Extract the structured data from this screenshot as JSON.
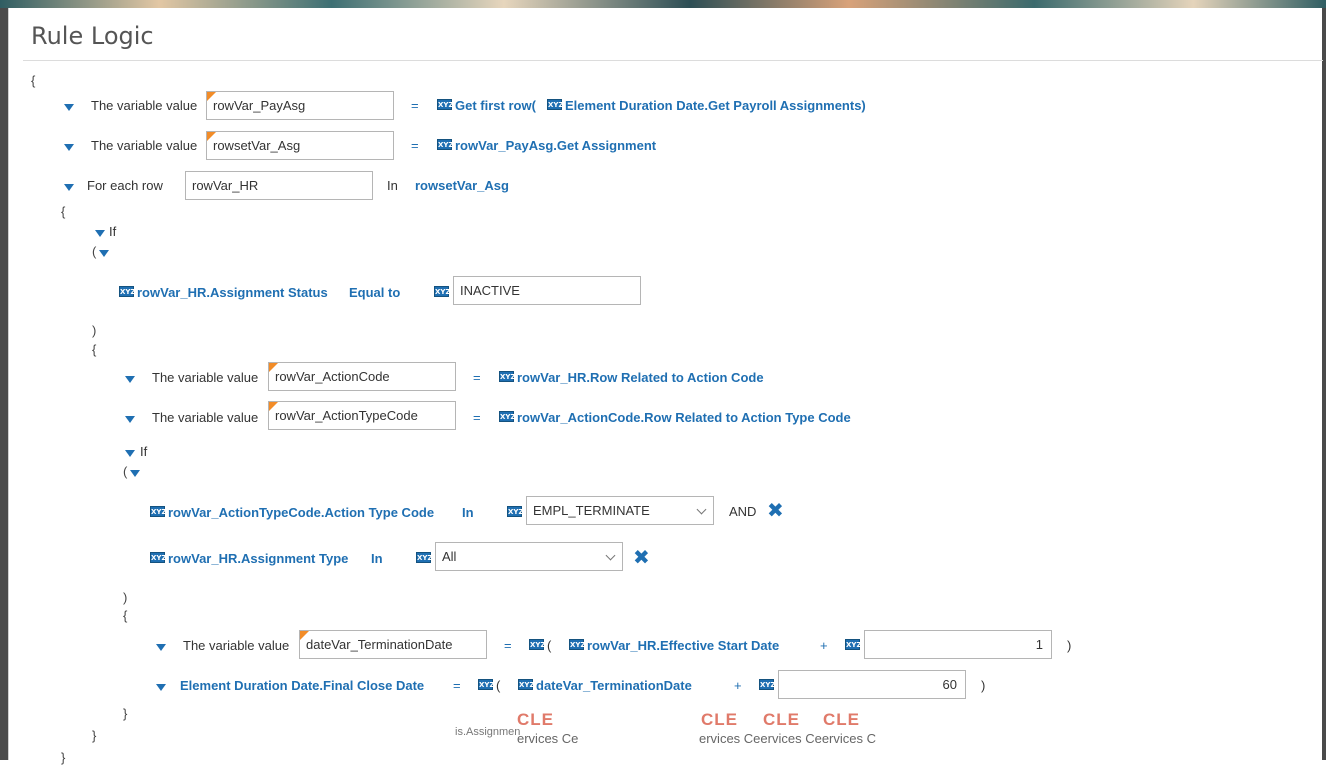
{
  "page": {
    "title": "Rule Logic"
  },
  "braces": {
    "open": "{",
    "close": "}",
    "paren_open": "(",
    "paren_close": ")"
  },
  "labels": {
    "variable_value": "The variable value",
    "for_each_row": "For each row",
    "in": "In",
    "if": "If",
    "equal_to": "Equal to",
    "and": "AND",
    "equals": "=",
    "plus": "+"
  },
  "icons": {
    "expression_icon": "xyz-expression-icon",
    "expression_text": "XYZ",
    "remove_icon": "close-x-icon"
  },
  "colors": {
    "link": "#1f6fb2",
    "flag": "#f28c28",
    "text": "#333333"
  },
  "rules": {
    "r1": {
      "var": "rowVar_PayAsg",
      "expr_a": "Get first row(",
      "expr_b": "Element Duration Date.Get Payroll Assignments)"
    },
    "r2": {
      "var": "rowsetVar_Asg",
      "expr": "rowVar_PayAsg.Get Assignment"
    },
    "loop": {
      "var": "rowVar_HR",
      "rowset": "rowsetVar_Asg"
    },
    "if1": {
      "lhs": "rowVar_HR.Assignment Status",
      "rhs": "INACTIVE"
    },
    "r3": {
      "var": "rowVar_ActionCode",
      "expr": "rowVar_HR.Row Related to Action Code"
    },
    "r4": {
      "var": "rowVar_ActionTypeCode",
      "expr": "rowVar_ActionCode.Row Related to Action Type Code"
    },
    "if2": {
      "c1_lhs": "rowVar_ActionTypeCode.Action Type Code",
      "c1_value": "EMPL_TERMINATE",
      "c2_lhs": "rowVar_HR.Assignment Type",
      "c2_value": "All"
    },
    "r5": {
      "var": "dateVar_TerminationDate",
      "expr": "rowVar_HR.Effective Start Date",
      "num": "1"
    },
    "r6": {
      "target": "Element Duration Date.Final Close Date",
      "expr": "dateVar_TerminationDate",
      "num": "60"
    }
  },
  "watermark": {
    "left_text": "is.Assignmen",
    "cle": "CLE",
    "left_services": "ervices Ce",
    "right_services": "ervices Ceervices Ceervices C"
  }
}
